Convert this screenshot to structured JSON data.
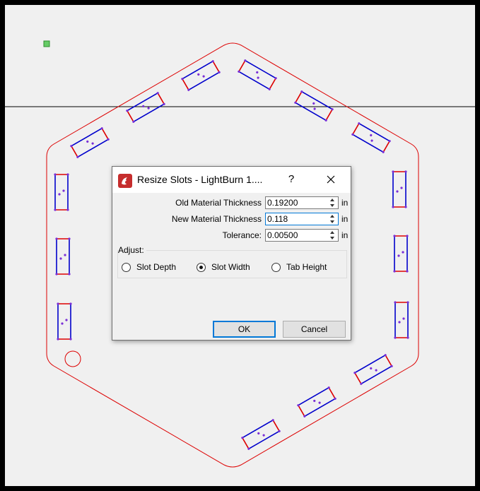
{
  "dialog": {
    "title": "Resize Slots - LightBurn 1....",
    "help_label": "?",
    "fields": [
      {
        "label": "Old Material Thickness",
        "value": "0.19200",
        "unit": "in"
      },
      {
        "label": "New Material Thickness",
        "value": "0.118",
        "unit": "in"
      },
      {
        "label": "Tolerance:",
        "value": "0.00500",
        "unit": "in"
      }
    ],
    "adjust_label": "Adjust:",
    "options": [
      {
        "label": "Slot Depth",
        "checked": false
      },
      {
        "label": "Slot Width",
        "checked": true
      },
      {
        "label": "Tab Height",
        "checked": false
      }
    ],
    "ok_label": "OK",
    "cancel_label": "Cancel"
  },
  "colors": {
    "cut_red": "#dd0000",
    "slot_blue": "#0000cc",
    "node_purple": "#7a2fd6",
    "marker_green": "#66cc66",
    "focus_blue": "#0078d7"
  },
  "icons": {
    "app": "lightburn-logo-icon",
    "help": "help-icon",
    "close": "close-icon"
  }
}
